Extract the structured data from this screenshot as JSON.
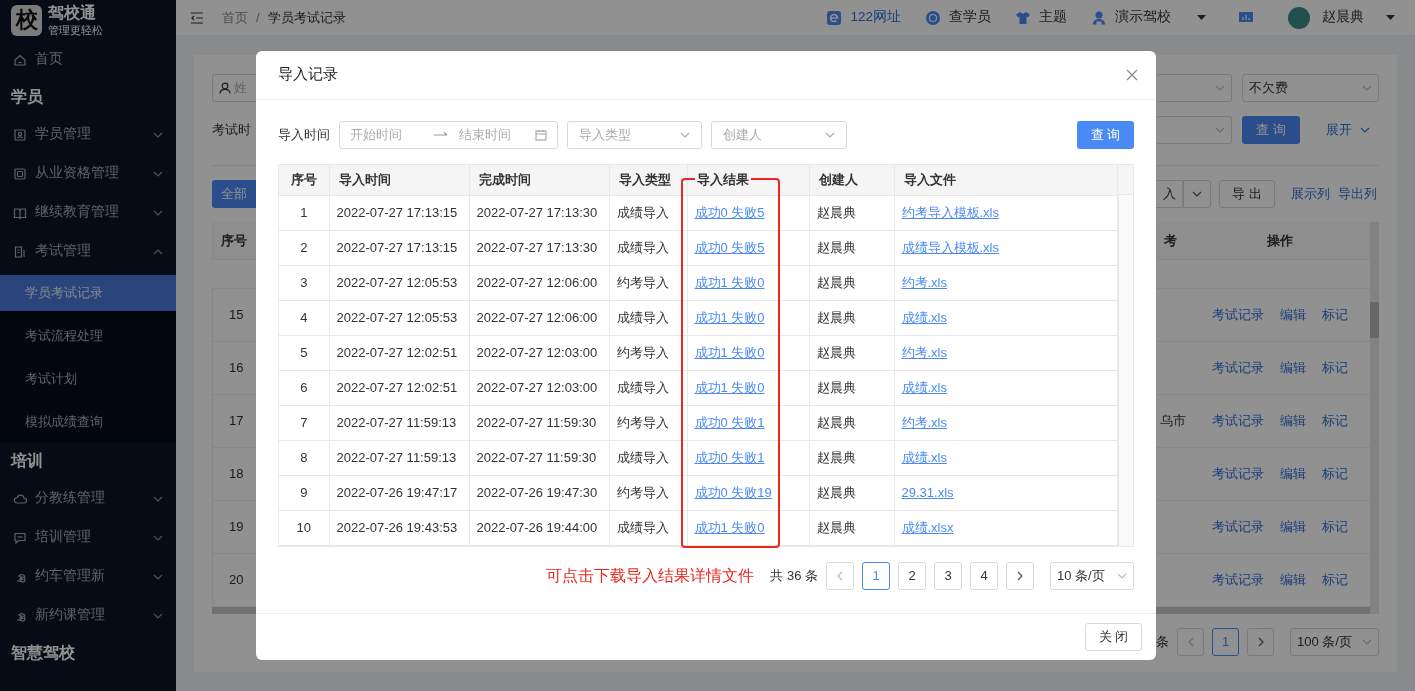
{
  "sidebar": {
    "logo": {
      "glyph": "校",
      "name": "驾校通",
      "slogan": "管理更轻松"
    },
    "nav": [
      {
        "kind": "item",
        "label": "首页"
      },
      {
        "kind": "section",
        "label": "学员"
      },
      {
        "kind": "group",
        "label": "学员管理",
        "expanded": false
      },
      {
        "kind": "group",
        "label": "从业资格管理",
        "expanded": false
      },
      {
        "kind": "group",
        "label": "继续教育管理",
        "expanded": false
      },
      {
        "kind": "group",
        "label": "考试管理",
        "expanded": true,
        "children": [
          {
            "label": "学员考试记录",
            "selected": true
          },
          {
            "label": "考试流程处理",
            "selected": false
          },
          {
            "label": "考试计划",
            "selected": false
          },
          {
            "label": "模拟成绩查询",
            "selected": false
          }
        ]
      },
      {
        "kind": "section",
        "label": "培训"
      },
      {
        "kind": "group",
        "label": "分教练管理",
        "expanded": false
      },
      {
        "kind": "group",
        "label": "培训管理",
        "expanded": false
      },
      {
        "kind": "group",
        "label": "约车管理新",
        "expanded": false
      },
      {
        "kind": "group",
        "label": "新约课管理",
        "expanded": false
      },
      {
        "kind": "section",
        "label": "智慧驾校"
      }
    ]
  },
  "topbar": {
    "breadcrumb": [
      "首页",
      "学员考试记录"
    ],
    "breadcrumb_separator": "/",
    "toolbar": [
      {
        "kind": "link",
        "label": "122网址"
      },
      {
        "kind": "action",
        "label": "查学员"
      },
      {
        "kind": "action",
        "label": "主题"
      },
      {
        "kind": "menu",
        "label": "演示驾校"
      }
    ],
    "user": {
      "name": "赵晨典"
    }
  },
  "page": {
    "name_field": {
      "placeholder": "姓"
    },
    "time_label": "考试时",
    "fee_select": {
      "value": "不欠费"
    },
    "query_button": "查 询",
    "expand_link": "展开",
    "all_button": "全部",
    "import_button": "入",
    "export_button": "导 出",
    "column_links": [
      "展示列",
      "导出列"
    ],
    "table": {
      "columns": [
        "序号",
        "考",
        "操作"
      ],
      "rows": [
        {
          "index": "15",
          "actions": [
            "考试记录",
            "编辑",
            "标记"
          ]
        },
        {
          "index": "16",
          "actions": [
            "考试记录",
            "编辑",
            "标记"
          ]
        },
        {
          "index": "17",
          "column_1": "乌市",
          "actions": [
            "考试记录",
            "编辑",
            "标记"
          ]
        },
        {
          "index": "18",
          "actions": [
            "考试记录",
            "编辑",
            "标记"
          ]
        },
        {
          "index": "19",
          "actions": [
            "考试记录",
            "编辑",
            "标记"
          ]
        },
        {
          "index": "20",
          "actions": [
            "考试记录",
            "编辑",
            "标记"
          ]
        }
      ]
    },
    "pagination": {
      "suffix": "条",
      "pages": [
        {
          "label": "1",
          "selected": true
        }
      ],
      "page_size": "100 条/页"
    }
  },
  "modal": {
    "title": "导入记录",
    "filters": {
      "time_label": "导入时间",
      "start_placeholder": "开始时间",
      "end_placeholder": "结束时间",
      "type_placeholder": "导入类型",
      "creator_placeholder": "创建人",
      "query_button": "查 询"
    },
    "table": {
      "columns": [
        "序号",
        "导入时间",
        "完成时间",
        "导入类型",
        "导入结果",
        "创建人",
        "导入文件"
      ],
      "rows": [
        {
          "index": "1",
          "import_time": "2022-07-27 17:13:15",
          "finish_time": "2022-07-27 17:13:30",
          "type": "成绩导入",
          "result": "成功0 失败5",
          "creator": "赵晨典",
          "file": "约考导入模板.xls"
        },
        {
          "index": "2",
          "import_time": "2022-07-27 17:13:15",
          "finish_time": "2022-07-27 17:13:30",
          "type": "成绩导入",
          "result": "成功0 失败5",
          "creator": "赵晨典",
          "file": "成绩导入模板.xls"
        },
        {
          "index": "3",
          "import_time": "2022-07-27 12:05:53",
          "finish_time": "2022-07-27 12:06:00",
          "type": "约考导入",
          "result": "成功1 失败0",
          "creator": "赵晨典",
          "file": "约考.xls"
        },
        {
          "index": "4",
          "import_time": "2022-07-27 12:05:53",
          "finish_time": "2022-07-27 12:06:00",
          "type": "成绩导入",
          "result": "成功1 失败0",
          "creator": "赵晨典",
          "file": "成绩.xls"
        },
        {
          "index": "5",
          "import_time": "2022-07-27 12:02:51",
          "finish_time": "2022-07-27 12:03:00",
          "type": "约考导入",
          "result": "成功1 失败0",
          "creator": "赵晨典",
          "file": "约考.xls"
        },
        {
          "index": "6",
          "import_time": "2022-07-27 12:02:51",
          "finish_time": "2022-07-27 12:03:00",
          "type": "成绩导入",
          "result": "成功1 失败0",
          "creator": "赵晨典",
          "file": "成绩.xls"
        },
        {
          "index": "7",
          "import_time": "2022-07-27 11:59:13",
          "finish_time": "2022-07-27 11:59:30",
          "type": "约考导入",
          "result": "成功0 失败1",
          "creator": "赵晨典",
          "file": "约考.xls"
        },
        {
          "index": "8",
          "import_time": "2022-07-27 11:59:13",
          "finish_time": "2022-07-27 11:59:30",
          "type": "成绩导入",
          "result": "成功0 失败1",
          "creator": "赵晨典",
          "file": "成绩.xls"
        },
        {
          "index": "9",
          "import_time": "2022-07-26 19:47:17",
          "finish_time": "2022-07-26 19:47:30",
          "type": "约考导入",
          "result": "成功0 失败19",
          "creator": "赵晨典",
          "file": "29.31.xls"
        },
        {
          "index": "10",
          "import_time": "2022-07-26 19:43:53",
          "finish_time": "2022-07-26 19:44:00",
          "type": "成绩导入",
          "result": "成功1 失败0",
          "creator": "赵晨典",
          "file": "成绩.xlsx"
        }
      ]
    },
    "annotation": "可点击下载导入结果详情文件",
    "pagination": {
      "total": "共 36 条",
      "pages": [
        {
          "label": "1",
          "selected": true
        },
        {
          "label": "2",
          "selected": false
        },
        {
          "label": "3",
          "selected": false
        },
        {
          "label": "4",
          "selected": false
        }
      ],
      "page_size": "10 条/页"
    },
    "close_button": "关 闭"
  }
}
